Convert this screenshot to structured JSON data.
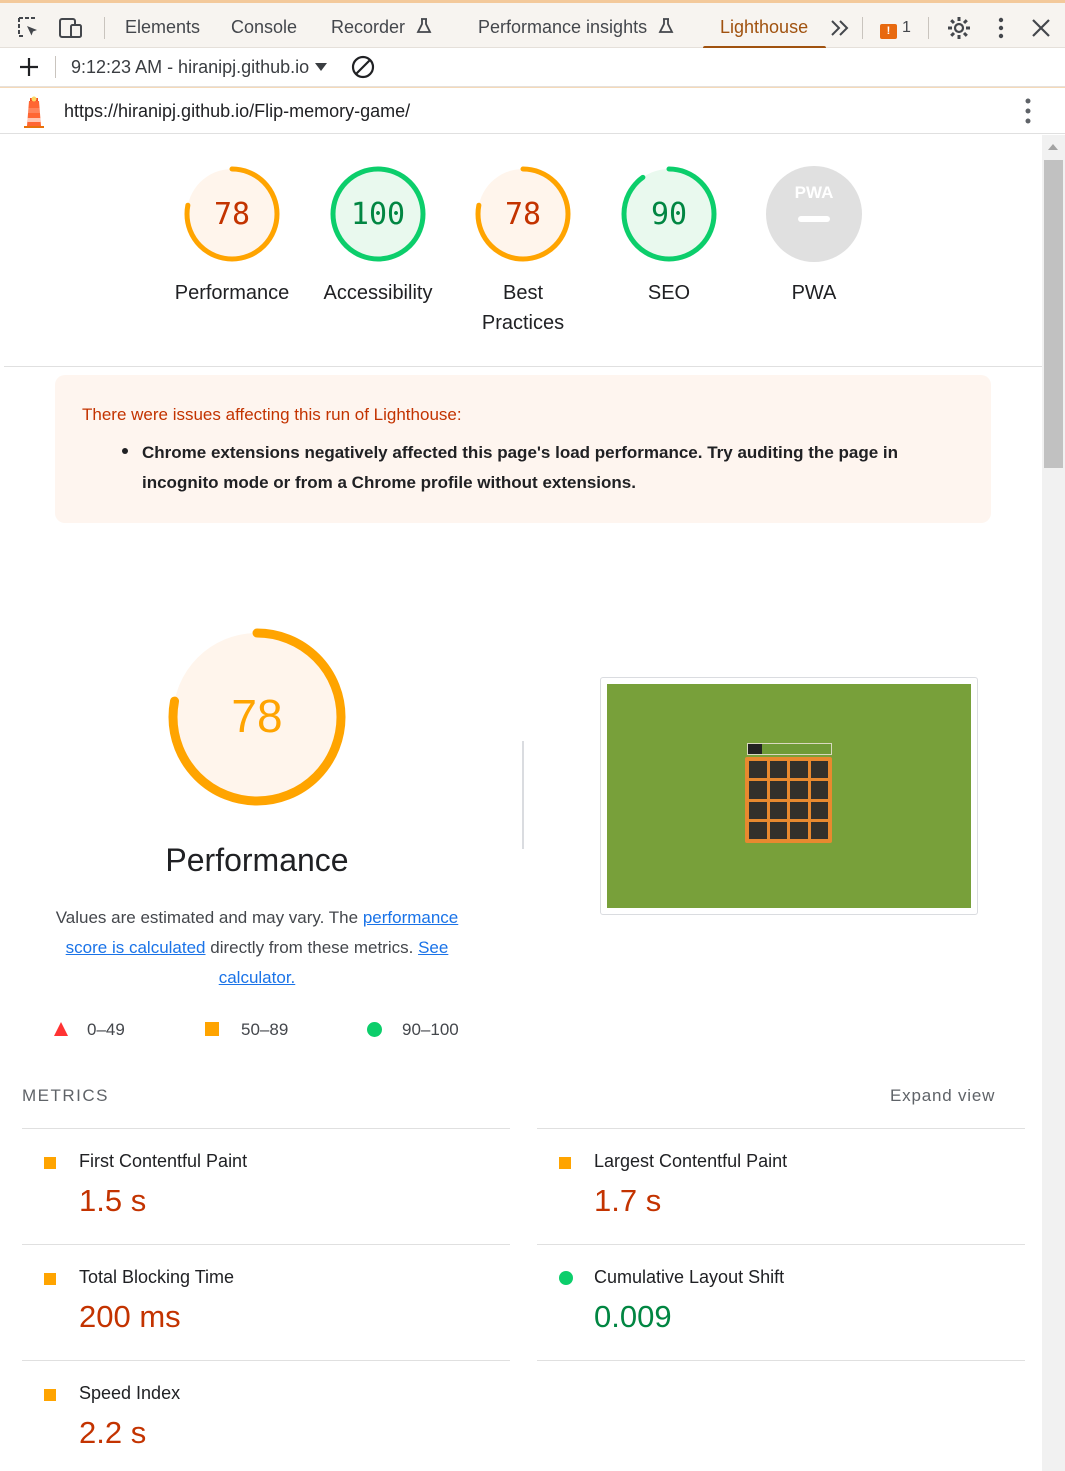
{
  "devtools": {
    "tabs": [
      {
        "label": "Elements"
      },
      {
        "label": "Console"
      },
      {
        "label": "Recorder"
      },
      {
        "label": "Performance insights"
      },
      {
        "label": "Lighthouse"
      }
    ],
    "active_tab": "Lighthouse",
    "issues_count": "1"
  },
  "toolbar": {
    "report_select": "9:12:23 AM - hiranipj.github.io"
  },
  "url_bar": {
    "url": "https://hiranipj.github.io/Flip-memory-game/"
  },
  "scores": [
    {
      "label": "Performance",
      "value": "78",
      "score": 78,
      "rating": "average"
    },
    {
      "label": "Accessibility",
      "value": "100",
      "score": 100,
      "rating": "pass"
    },
    {
      "label_line1": "Best",
      "label_line2": "Practices",
      "value": "78",
      "score": 78,
      "rating": "average"
    },
    {
      "label": "SEO",
      "value": "90",
      "score": 90,
      "rating": "pass"
    },
    {
      "label": "PWA",
      "badge_text": "PWA",
      "rating": "na"
    }
  ],
  "warning": {
    "title": "There were issues affecting this run of Lighthouse:",
    "items": [
      "Chrome extensions negatively affected this page's load performance. Try auditing the page in incognito mode or from a Chrome profile without extensions."
    ]
  },
  "performance": {
    "score": "78",
    "score_value": 78,
    "title": "Performance",
    "desc_part1": "Values are estimated and may vary. The ",
    "desc_link1": "performance score is calculated",
    "desc_part2": " directly from these metrics. ",
    "desc_link2": "See calculator."
  },
  "legend": [
    {
      "range": "0–49",
      "shape": "triangle",
      "color": "#ff3333"
    },
    {
      "range": "50–89",
      "shape": "square",
      "color": "#ffa400"
    },
    {
      "range": "90–100",
      "shape": "circle",
      "color": "#0cce6b"
    }
  ],
  "metrics": {
    "header": "METRICS",
    "expand": "Expand view",
    "items": [
      {
        "name": "First Contentful Paint",
        "value": "1.5 s",
        "rating": "average"
      },
      {
        "name": "Largest Contentful Paint",
        "value": "1.7 s",
        "rating": "average"
      },
      {
        "name": "Total Blocking Time",
        "value": "200 ms",
        "rating": "average"
      },
      {
        "name": "Cumulative Layout Shift",
        "value": "0.009",
        "rating": "pass"
      },
      {
        "name": "Speed Index",
        "value": "2.2 s",
        "rating": "average"
      }
    ]
  },
  "colors": {
    "average": "#ffa400",
    "average_text": "#c33300",
    "pass": "#0cce6b",
    "pass_text": "#018642",
    "fail": "#ff3333",
    "accent": "#a0520f"
  }
}
